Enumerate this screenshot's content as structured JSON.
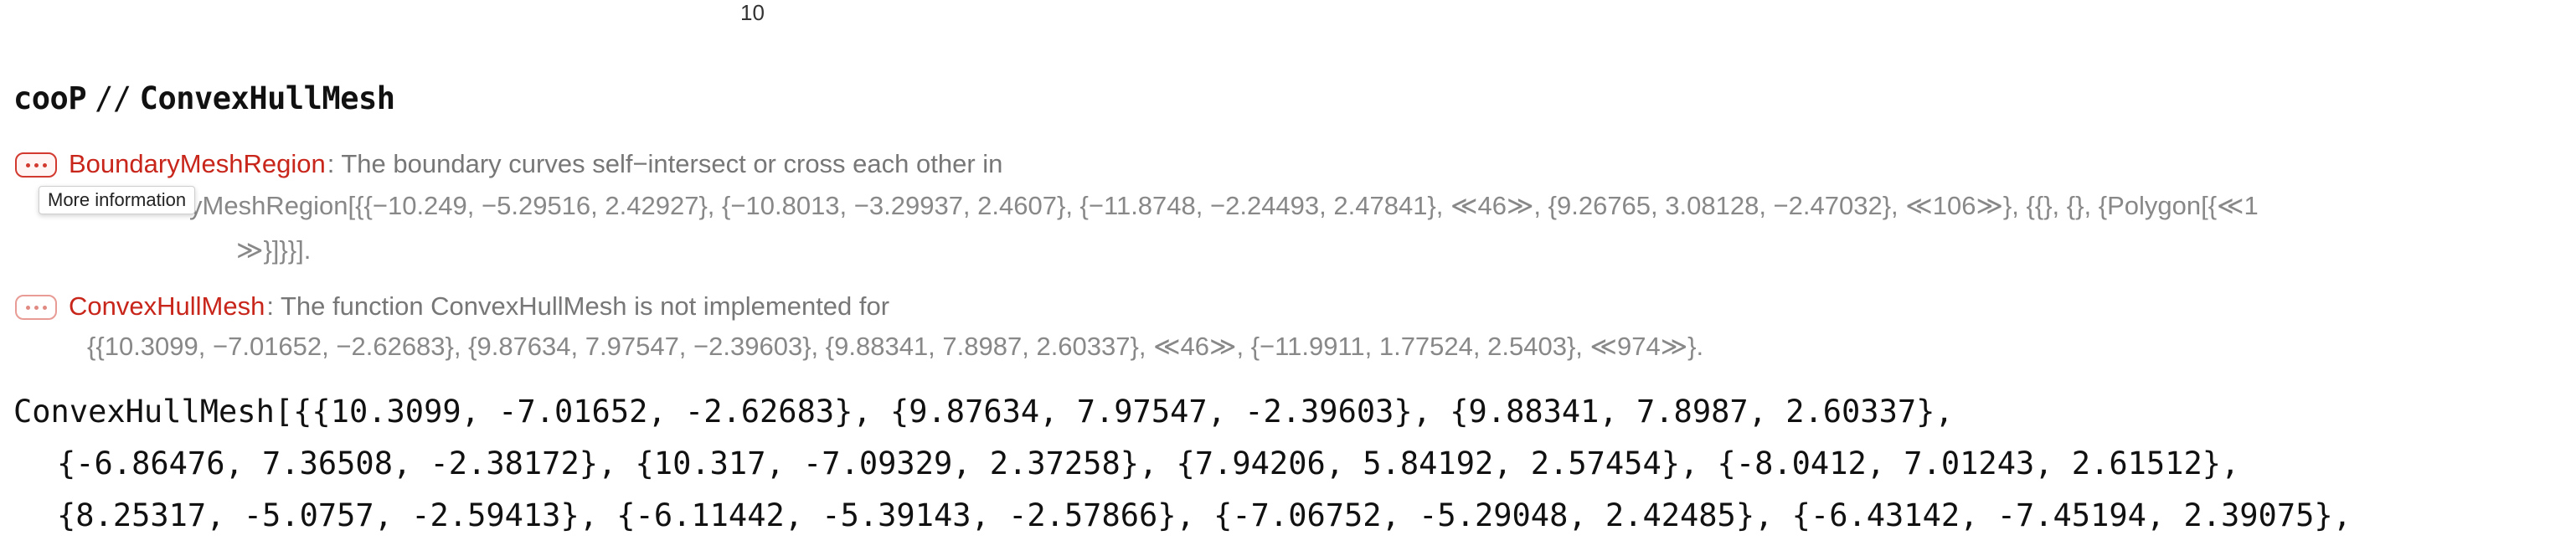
{
  "plot_tick": "10",
  "input": {
    "symbol": "cooP",
    "operator": "//",
    "function": "ConvexHullMesh"
  },
  "messages": [
    {
      "name": "BoundaryMeshRegion",
      "text": "The boundary curves self−intersect or cross each other in",
      "expr_line1_hidden_prefix": "Boundar",
      "expr_line1": "yMeshRegion[{{−10.249, −5.29516, 2.42927}, {−10.8013, −3.29937, 2.4607}, {−11.8748, −2.24493, 2.47841}, ≪46≫, {9.26765, 3.08128, −2.47032}, ≪106≫}, {{}, {}, {Polygon[{≪1",
      "expr_line2": "≫}]}}].",
      "tooltip": "More information"
    },
    {
      "name": "ConvexHullMesh",
      "text": "The function ConvexHullMesh is not implemented for",
      "expr_line1": "{{10.3099, −7.01652, −2.62683}, {9.87634, 7.97547, −2.39603}, {9.88341, 7.8987, 2.60337}, ≪46≫, {−11.9911, 1.77524, 2.5403}, ≪974≫}."
    }
  ],
  "output": {
    "lines": [
      "ConvexHullMesh[{{10.3099, -7.01652, -2.62683}, {9.87634, 7.97547, -2.39603}, {9.88341, 7.8987, 2.60337},",
      "{-6.86476, 7.36508, -2.38172}, {10.317, -7.09329, 2.37258}, {7.94206, 5.84192, 2.57454}, {-8.0412, 7.01243, 2.61512},",
      "{8.25317, -5.0757, -2.59413}, {-6.11442, -5.39143, -2.57866}, {-7.06752, -5.29048, 2.42485}, {-6.43142, -7.45194, 2.39075},"
    ]
  },
  "colors": {
    "message_name": "#c8251b",
    "message_text": "#777777",
    "message_button_border": "#d23a2f"
  }
}
